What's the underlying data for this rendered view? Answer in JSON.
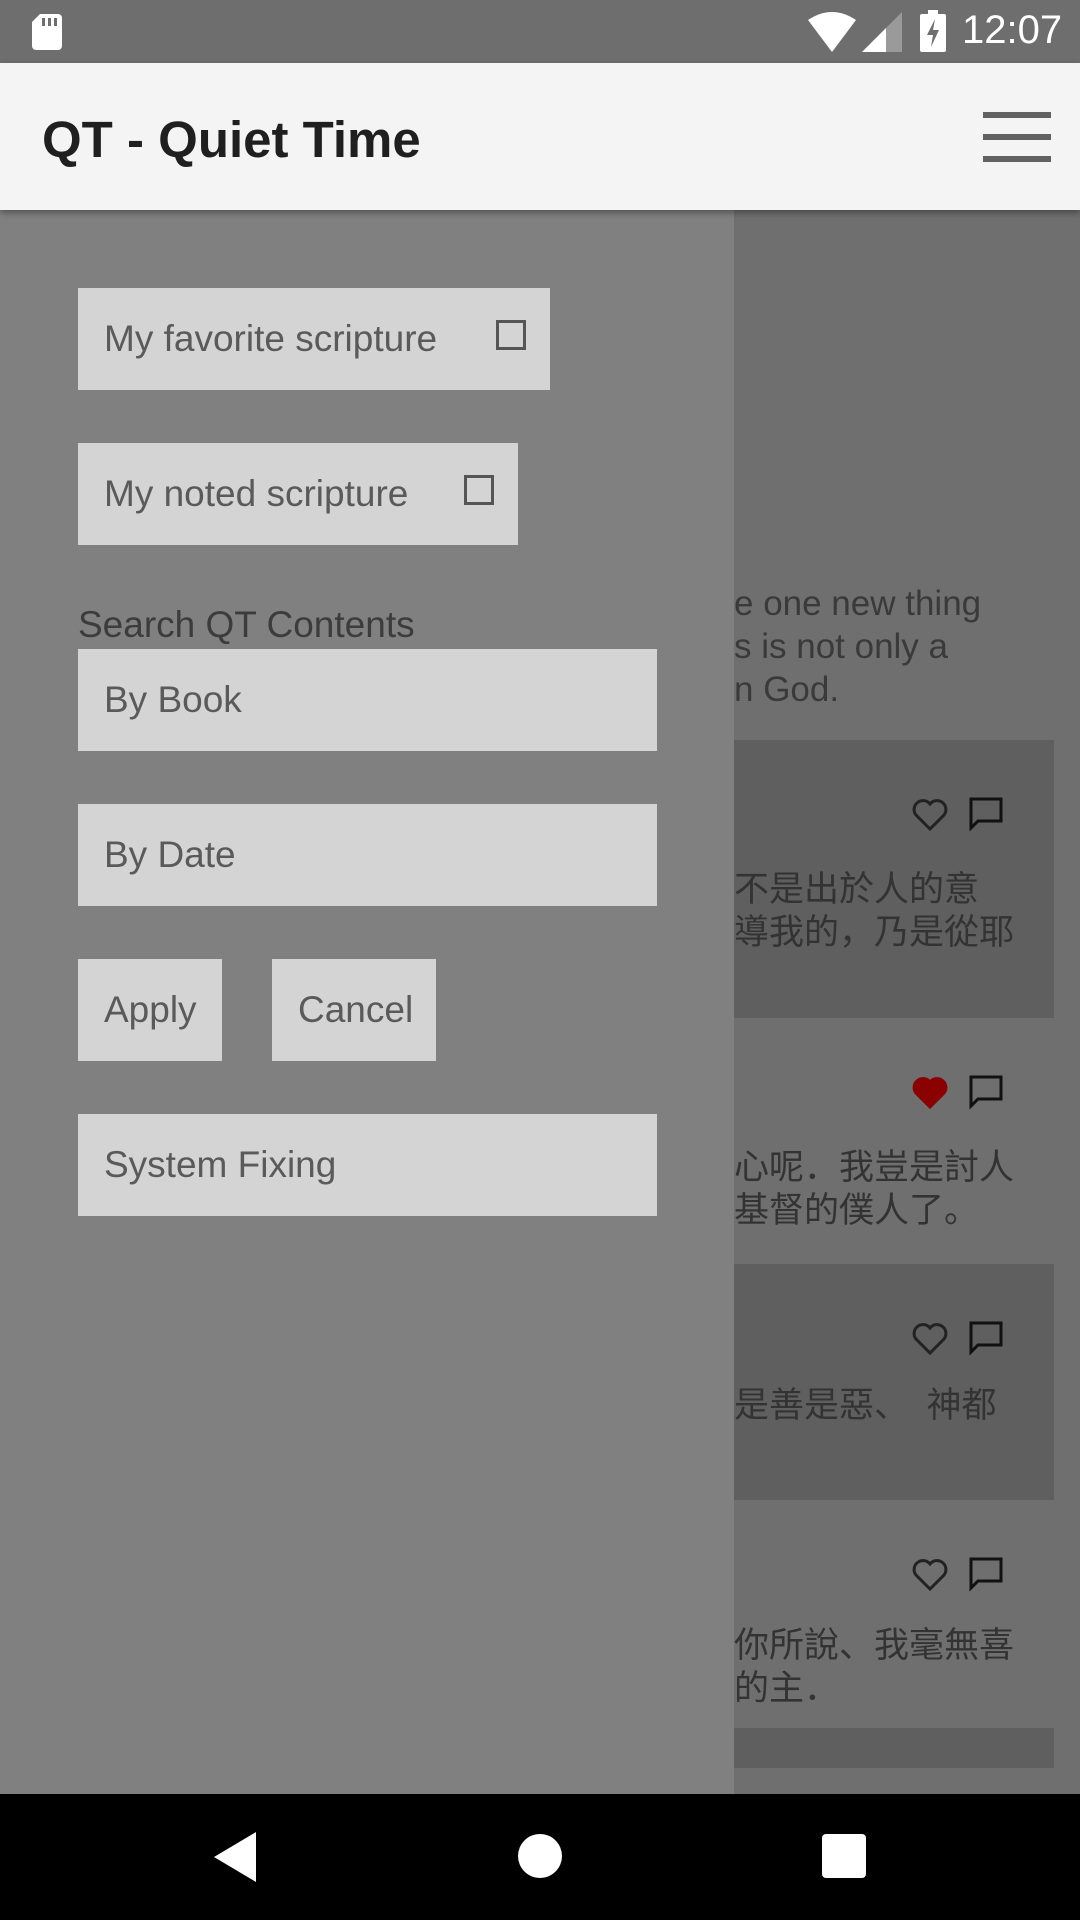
{
  "status_bar": {
    "time": "12:07",
    "icons": [
      "sd-card-icon",
      "wifi-icon",
      "signal-icon",
      "battery-charging-icon"
    ]
  },
  "app_bar": {
    "title": "QT - Quiet Time",
    "menu_icon": "hamburger-menu-icon"
  },
  "drawer": {
    "favorite_label": "My favorite scripture",
    "noted_label": "My noted scripture",
    "favorite_checked": false,
    "noted_checked": false,
    "search_heading": "Search QT Contents",
    "by_book": "By Book",
    "by_date": "By Date",
    "apply": "Apply",
    "cancel": "Cancel",
    "system_fixing": "System Fixing"
  },
  "feed": {
    "intro_lines": [
      "e one new thing",
      "s is not only a",
      "n God."
    ],
    "cards": [
      {
        "lines": [
          "不是出於人的意",
          "導我的，乃是從耶"
        ],
        "favorited": false
      },
      {
        "lines": [
          "心呢．我豈是討人",
          "基督的僕人了。"
        ],
        "favorited": true
      },
      {
        "lines": [
          "是善是惡、　神都"
        ],
        "favorited": false
      },
      {
        "lines": [
          "你所說、我毫無喜",
          "的主．"
        ],
        "favorited": false
      }
    ]
  },
  "nav_bar": {
    "icons": [
      "back-icon",
      "home-icon",
      "recents-icon"
    ]
  },
  "colors": {
    "heart_favorited": "#8b0000",
    "drawer_background": "#808080",
    "button_background": "#d4d4d4"
  }
}
